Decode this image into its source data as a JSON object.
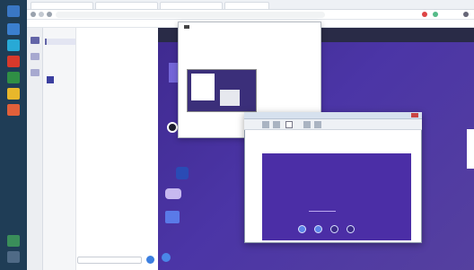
{
  "browser": {
    "tabs": [
      "",
      "",
      "",
      ""
    ],
    "url": "",
    "bookmarks": ""
  },
  "teams": {
    "sidebar_lines": [
      "",
      "",
      "",
      "",
      ""
    ],
    "chat_lines": [
      "",
      "",
      "",
      ""
    ],
    "search_placeholder": ""
  },
  "stage": {
    "headline": "",
    "side_text": ""
  },
  "popup": {
    "line1": "",
    "line2": ""
  },
  "dialog": {
    "title": "",
    "heading": "",
    "line1": "",
    "line2": ""
  }
}
